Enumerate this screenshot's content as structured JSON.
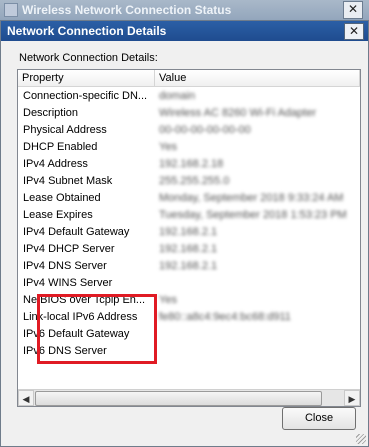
{
  "background_window": {
    "title": "Wireless Network Connection Status",
    "close_label": "✕"
  },
  "dialog": {
    "title": "Network Connection Details",
    "close_label": "✕",
    "group_label": "Network Connection Details:",
    "columns": {
      "property": "Property",
      "value": "Value"
    },
    "rows": [
      {
        "property": "Connection-specific DN...",
        "value": "domain"
      },
      {
        "property": "Description",
        "value": "Wireless AC 8260 Wi-Fi Adapter"
      },
      {
        "property": "Physical Address",
        "value": "00-00-00-00-00-00"
      },
      {
        "property": "DHCP Enabled",
        "value": "Yes"
      },
      {
        "property": "IPv4 Address",
        "value": "192.168.2.18"
      },
      {
        "property": "IPv4 Subnet Mask",
        "value": "255.255.255.0"
      },
      {
        "property": "Lease Obtained",
        "value": "Monday, September 2018 9:33:24 AM"
      },
      {
        "property": "Lease Expires",
        "value": "Tuesday, September 2018 1:53:23 PM"
      },
      {
        "property": "IPv4 Default Gateway",
        "value": "192.168.2.1"
      },
      {
        "property": "IPv4 DHCP Server",
        "value": "192.168.2.1"
      },
      {
        "property": "IPv4 DNS Server",
        "value": "192.168.2.1"
      },
      {
        "property": "IPv4 WINS Server",
        "value": ""
      },
      {
        "property": "NetBIOS over Tcpip En...",
        "value": "Yes"
      },
      {
        "property": "Link-local IPv6 Address",
        "value": "fe80::a8c4:9ec4:bc68:d911"
      },
      {
        "property": "IPv6 Default Gateway",
        "value": ""
      },
      {
        "property": "IPv6 DNS Server",
        "value": ""
      }
    ],
    "close_button": "Close"
  },
  "colors": {
    "highlight": "#e01b24",
    "titlebar": "#1f4c8f"
  }
}
